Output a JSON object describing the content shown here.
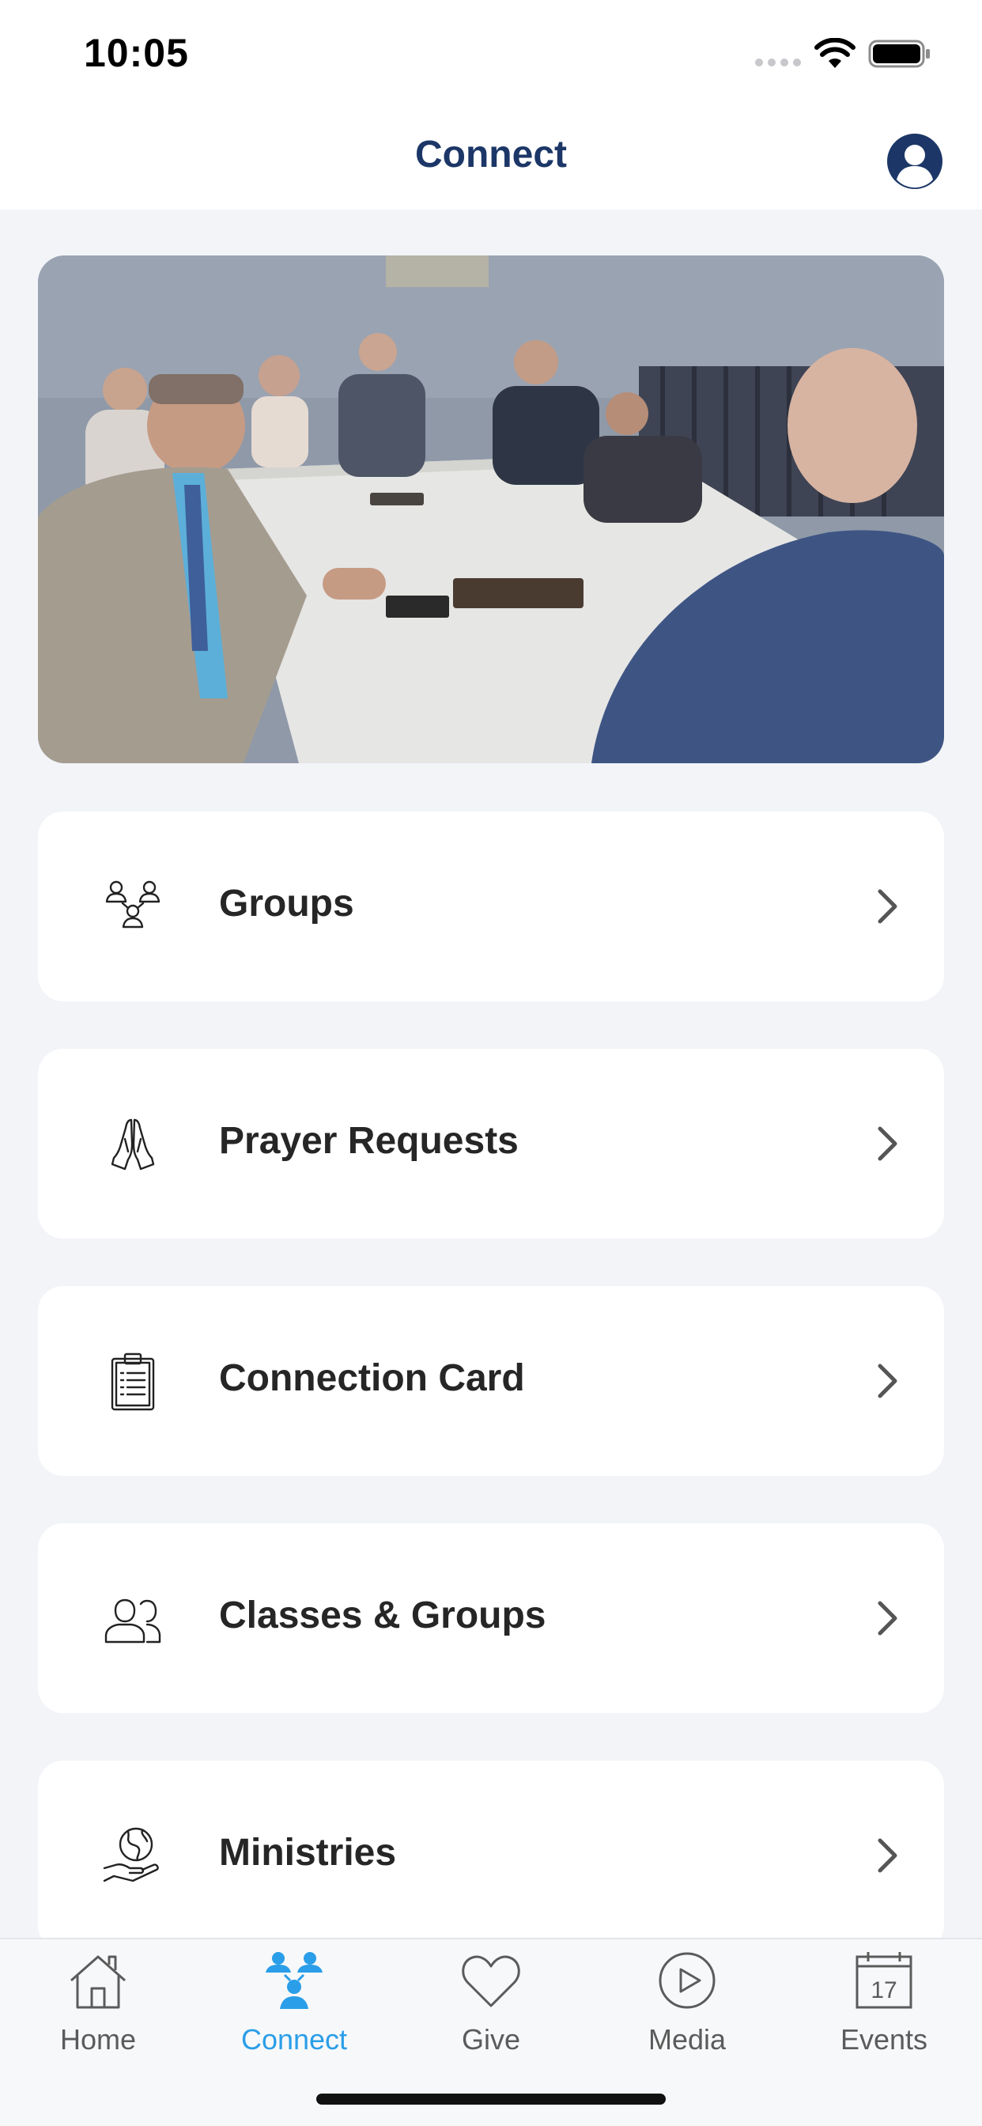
{
  "status_bar": {
    "time": "10:05",
    "icons": [
      "cellular-signal-icon",
      "wifi-icon",
      "battery-icon"
    ]
  },
  "header": {
    "title": "Connect",
    "profile_icon": "profile-icon"
  },
  "hero": {
    "image": "group-meeting-photo"
  },
  "menu": [
    {
      "label": "Groups",
      "icon": "groups-icon"
    },
    {
      "label": "Prayer Requests",
      "icon": "praying-hands-icon"
    },
    {
      "label": "Connection Card",
      "icon": "clipboard-icon"
    },
    {
      "label": "Classes & Groups",
      "icon": "people-icon"
    },
    {
      "label": "Ministries",
      "icon": "globe-hand-icon"
    }
  ],
  "tabs": [
    {
      "label": "Home",
      "icon": "home-icon",
      "active": false
    },
    {
      "label": "Connect",
      "icon": "connect-icon",
      "active": true
    },
    {
      "label": "Give",
      "icon": "heart-icon",
      "active": false
    },
    {
      "label": "Media",
      "icon": "play-icon",
      "active": false
    },
    {
      "label": "Events",
      "icon": "calendar-icon",
      "active": false,
      "badge_text": "17"
    }
  ],
  "colors": {
    "title": "#1c3767",
    "accent": "#2a9ee8",
    "background": "#f2f4f8",
    "card": "#ffffff"
  }
}
